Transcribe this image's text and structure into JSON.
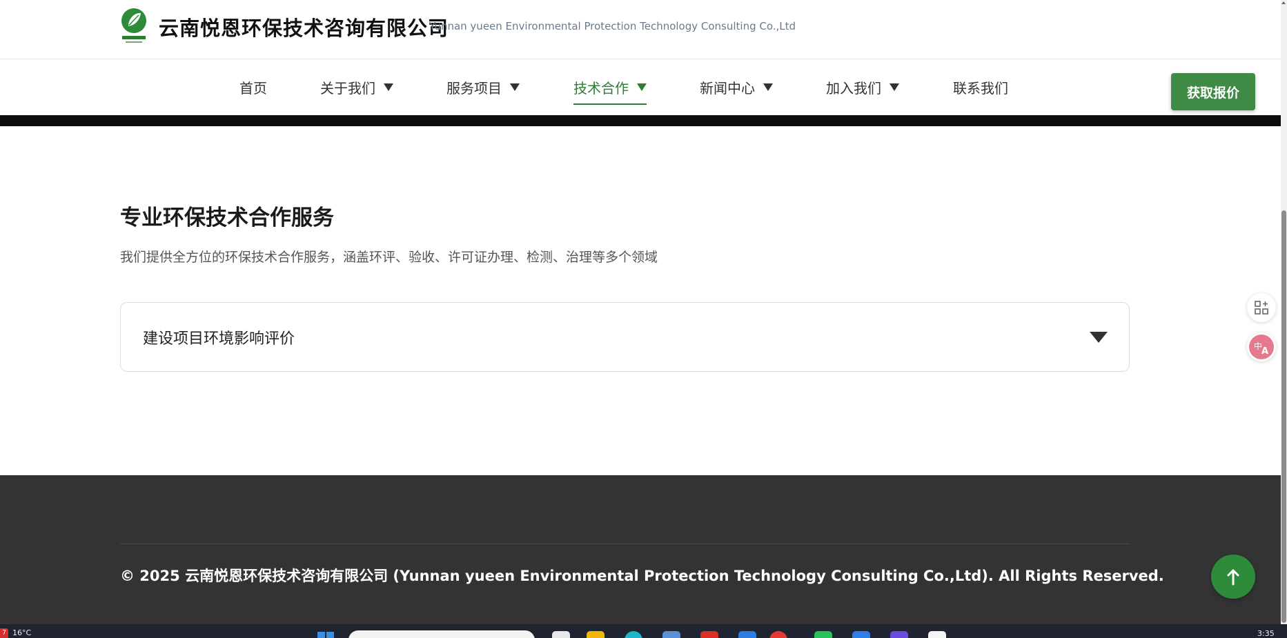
{
  "header": {
    "company_name": "云南悦恩环保技术咨询有限公司",
    "company_name_en": "Yunnan yueen Environmental Protection Technology Consulting Co.,Ltd",
    "logo_icon": "leaf-logo-icon",
    "quote_button": "获取报价"
  },
  "nav": {
    "items": [
      {
        "label": "首页",
        "has_dropdown": false
      },
      {
        "label": "关于我们",
        "has_dropdown": true
      },
      {
        "label": "服务项目",
        "has_dropdown": true
      },
      {
        "label": "技术合作",
        "has_dropdown": true,
        "active": true
      },
      {
        "label": "新闻中心",
        "has_dropdown": true
      },
      {
        "label": "加入我们",
        "has_dropdown": true
      },
      {
        "label": "联系我们",
        "has_dropdown": false
      }
    ]
  },
  "main": {
    "title": "专业环保技术合作服务",
    "description": "我们提供全方位的环保技术合作服务，涵盖环评、验收、许可证办理、检测、治理等多个领域",
    "accordion": [
      {
        "title": "建设项目环境影响评价",
        "expanded": false
      }
    ]
  },
  "footer": {
    "copyright": "© 2025 云南悦恩环保技术咨询有限公司 (Yunnan yueen Environmental Protection Technology Consulting Co.,Ltd). All Rights Reserved."
  },
  "side_tools": [
    "apps-grid-icon",
    "translate-icon"
  ],
  "back_to_top_icon": "arrow-up-icon",
  "taskbar": {
    "weather_badge": "7",
    "temperature": "16°C",
    "time": "3:35"
  },
  "colors": {
    "brand_green": "#2e7d32",
    "button_green": "#3f8a44",
    "footer_bg": "#333333",
    "strip_black": "#0d0d0d"
  }
}
